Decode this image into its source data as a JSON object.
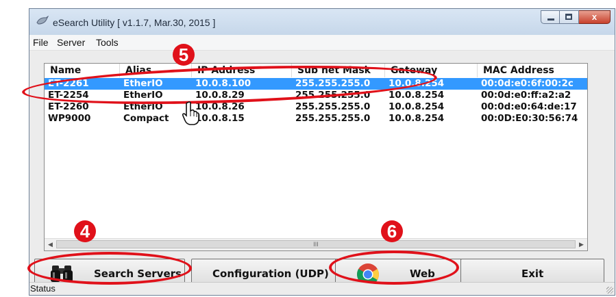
{
  "window": {
    "title": "eSearch Utility [ v1.1.7, Mar.30, 2015 ]",
    "close_glyph": "x"
  },
  "menu": [
    "File",
    "Server",
    "Tools"
  ],
  "table": {
    "columns": [
      "Name",
      "Alias",
      "IP Address",
      "Sub net Mask",
      "Gateway",
      "MAC Address"
    ],
    "rows": [
      [
        "ET-2261",
        "EtherIO",
        "10.0.8.100",
        "255.255.255.0",
        "10.0.8.254",
        "00:0d:e0:6f:00:2c"
      ],
      [
        "ET-2254",
        "EtherIO",
        "10.0.8.29",
        "255.255.255.0",
        "10.0.8.254",
        "00:0d:e0:ff:a2:a2"
      ],
      [
        "ET-2260",
        "EtherIO",
        "10.0.8.26",
        "255.255.255.0",
        "10.0.8.254",
        "00:0d:e0:64:de:17"
      ],
      [
        "WP9000",
        "Compact",
        "10.0.8.15",
        "255.255.255.0",
        "10.0.8.254",
        "00:0D:E0:30:56:74"
      ]
    ],
    "selected_row": 0,
    "scroll_left": "◀",
    "scroll_right": "▶",
    "scroll_grip": "III"
  },
  "buttons": {
    "search": "Search Servers",
    "config": "Configuration (UDP)",
    "web": "Web",
    "exit": "Exit"
  },
  "status": "Status",
  "annotations": [
    "5",
    "4",
    "6"
  ],
  "colors": {
    "selection": "#3399ff",
    "annotation": "#e0111a"
  }
}
